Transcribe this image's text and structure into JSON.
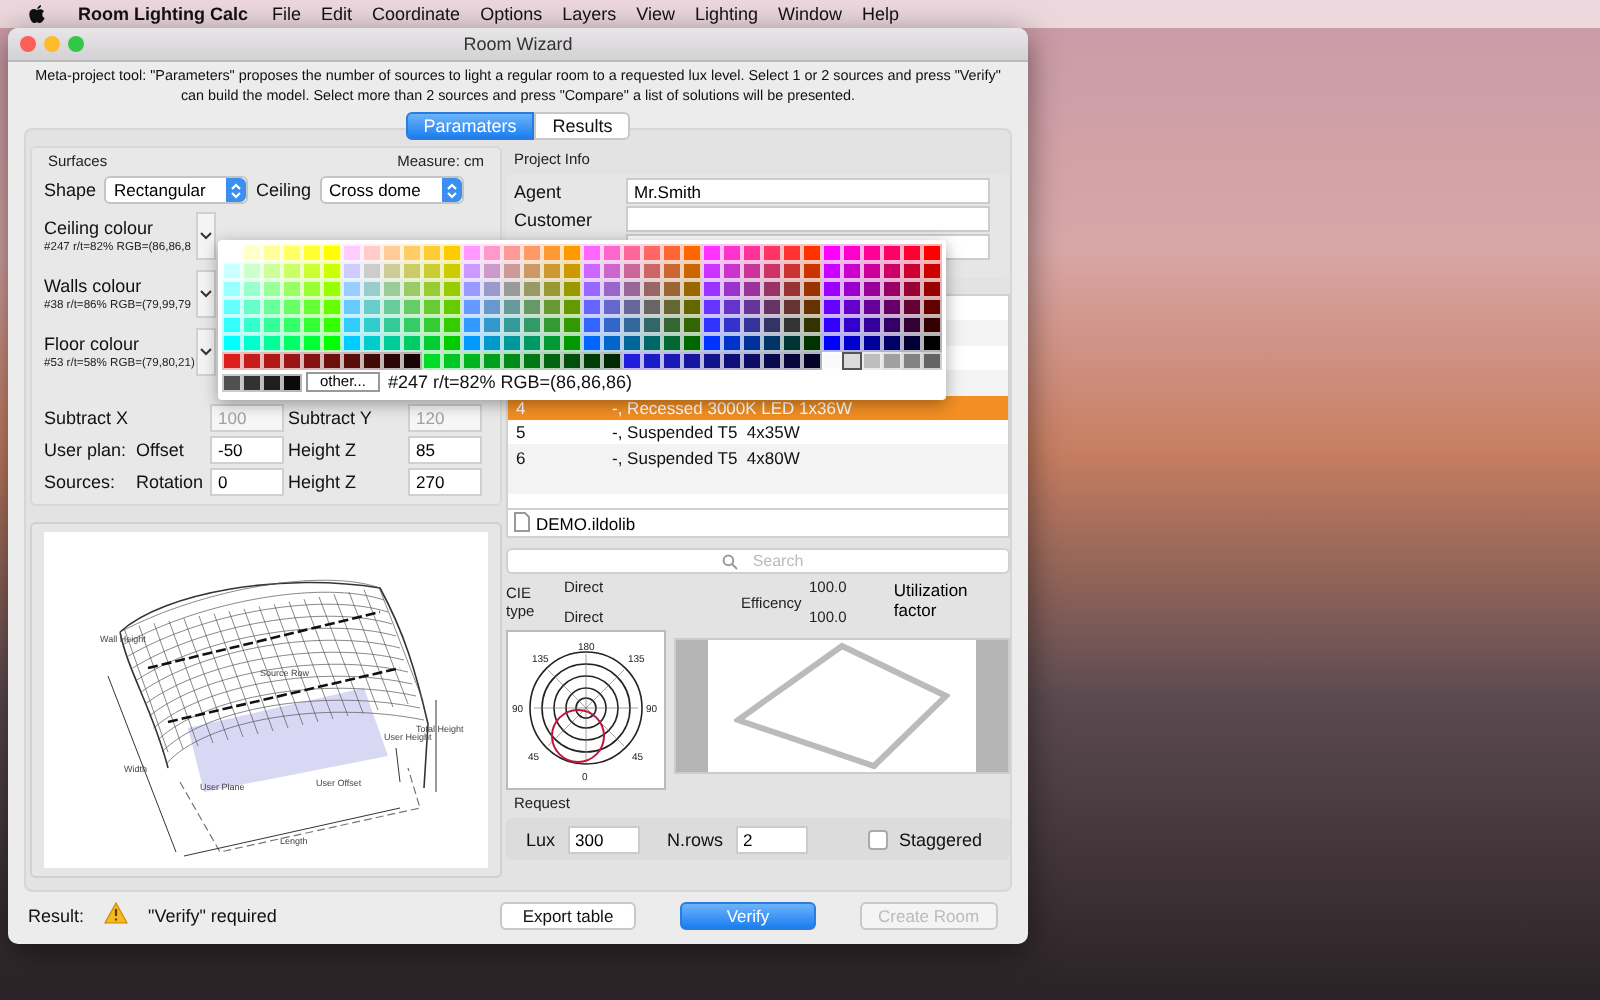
{
  "menu_bar": {
    "app": "Room Lighting Calc",
    "items": [
      "File",
      "Edit",
      "Coordinate",
      "Options",
      "Layers",
      "View",
      "Lighting",
      "Window",
      "Help"
    ]
  },
  "window": {
    "title": "Room Wizard"
  },
  "description": "Meta-project tool: \"Parameters\" proposes the number of sources to light a regular room to a requested lux level. Select 1 or 2 sources and press \"Verify\" can build the model. Select more than 2 sources and press \"Compare\" a list of solutions will be presented.",
  "tabs": [
    {
      "label": "Paramaters",
      "selected": true
    },
    {
      "label": "Results",
      "selected": false
    }
  ],
  "surfaces": {
    "title": "Surfaces",
    "measure": "Measure: cm",
    "selects": [
      {
        "label": "Shape",
        "value": "Rectangular"
      },
      {
        "label": "Ceiling",
        "value": "Cross dome"
      }
    ],
    "colours": [
      {
        "label": "Ceiling colour",
        "info": "#247 r/t=82% RGB=(86,86,8"
      },
      {
        "label": "Walls colour",
        "info": "#38 r/t=86% RGB=(79,99,79"
      },
      {
        "label": "Floor colour",
        "info": "#53 r/t=58% RGB=(79,80,21)"
      }
    ],
    "rows": [
      {
        "fields": [
          {
            "label": "Subtract X",
            "value": "100",
            "disabled": true
          },
          {
            "label": "Subtract Y",
            "value": "120",
            "disabled": true
          }
        ]
      },
      {
        "prefix": "User plan:",
        "fields": [
          {
            "label": "Offset",
            "value": "-50",
            "disabled": false
          },
          {
            "label": "Height Z",
            "value": "85",
            "disabled": false
          }
        ]
      },
      {
        "prefix": "Sources:",
        "fields": [
          {
            "label": "Rotation",
            "value": "0",
            "disabled": false
          },
          {
            "label": "Height Z",
            "value": "270",
            "disabled": false
          }
        ]
      }
    ]
  },
  "room_diagram": {
    "labels": [
      "Wall Height",
      "Source Row",
      "Total Height",
      "User Height",
      "Width",
      "User Plane",
      "User Offset",
      "Length"
    ]
  },
  "colour_popup": {
    "other_button": "other...",
    "info": "#247 r/t=82% RGB=(86,86,86)"
  },
  "project_info": {
    "title": "Project Info",
    "fields": [
      {
        "label": "Agent",
        "value": "Mr.Smith"
      },
      {
        "label": "Customer"
      }
    ]
  },
  "sources": {
    "rows": [
      {
        "number": "4",
        "name": "-, Recessed 3000K LED 1x36W",
        "selected": true
      },
      {
        "number": "5",
        "name": "-, Suspended T5  4x35W",
        "selected": false
      },
      {
        "number": "6",
        "name": "-, Suspended T5  4x80W",
        "selected": false
      }
    ],
    "file": "DEMO.ildolib"
  },
  "search": {
    "placeholder": "Search"
  },
  "luminaire": {
    "cie_label": "CIE type",
    "cie_values": [
      "Direct",
      "Direct"
    ],
    "efficiency_label": "Efficency",
    "efficiency_values": [
      "100.0",
      "100.0"
    ],
    "utilization": "Utilization factor",
    "polar_labels": [
      "180",
      "135",
      "135",
      "90",
      "90",
      "45",
      "45",
      "0"
    ]
  },
  "request": {
    "title": "Request",
    "lux_label": "Lux",
    "lux": "300",
    "rows_label": "N.rows",
    "rows": "2",
    "staggered": {
      "label": "Staggered",
      "checked": false
    }
  },
  "result": {
    "label": "Result:",
    "text": "\"Verify\" required"
  },
  "buttons": [
    {
      "label": "Export table",
      "kind": "normal"
    },
    {
      "label": "Verify",
      "kind": "primary"
    },
    {
      "label": "Create Room",
      "kind": "disabled"
    }
  ]
}
